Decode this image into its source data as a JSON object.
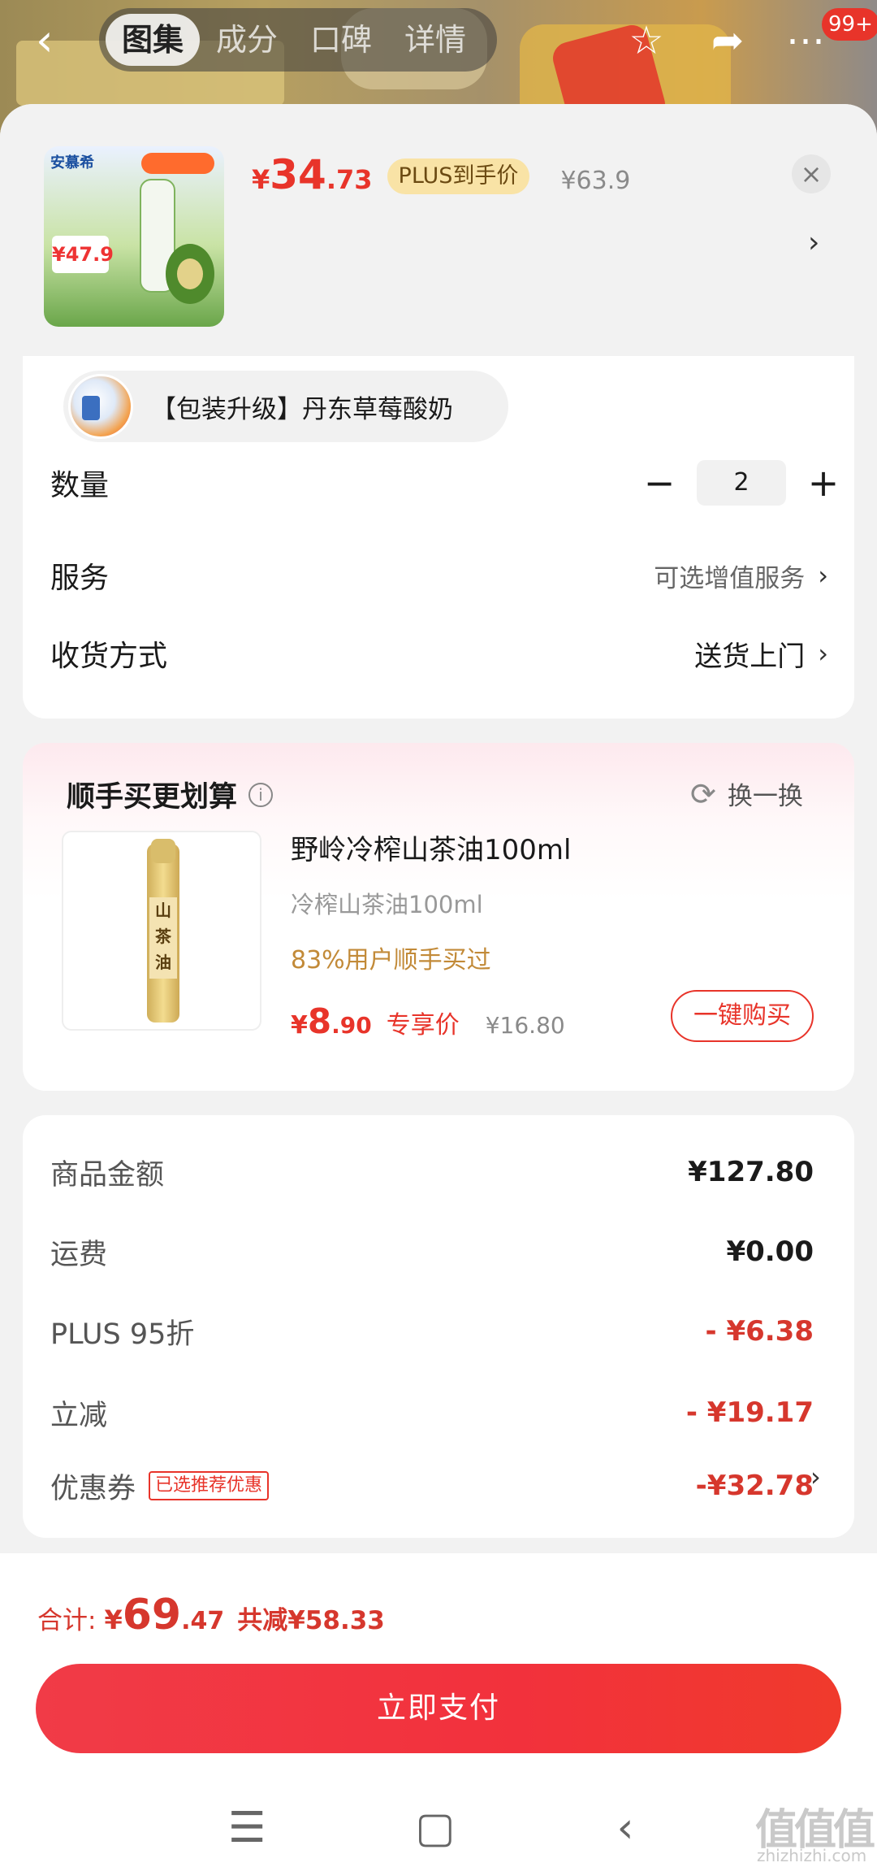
{
  "top_nav": {
    "tabs": [
      "图集",
      "成分",
      "口碑",
      "详情"
    ],
    "active_tab": 0,
    "badge": "99+",
    "icons": [
      "back-icon",
      "star-icon",
      "share-icon",
      "more-icon"
    ]
  },
  "product": {
    "price_symbol": "¥",
    "price_int": "34",
    "price_dec": ".73",
    "plus_tag": "PLUS到手价",
    "original_price": "¥63.9",
    "close_label": "×",
    "thumb_brand": "安慕希",
    "thumb_price": "¥47.9"
  },
  "variant": {
    "label": "【包装升级】丹东草莓酸奶"
  },
  "options": {
    "quantity_label": "数量",
    "quantity_value": "2",
    "minus": "−",
    "plus": "+",
    "service_label": "服务",
    "service_value": "可选增值服务",
    "delivery_label": "收货方式",
    "delivery_value": "送货上门"
  },
  "recommend": {
    "title": "顺手买更划算",
    "swap_label": "换一换",
    "name": "野岭冷榨山茶油100ml",
    "subtitle": "冷榨山茶油100ml",
    "stat": "83%用户顺手买过",
    "price_symbol": "¥",
    "price_int": "8",
    "price_dec": ".90",
    "price_tag": "专享价",
    "original_price": "¥16.80",
    "buy_label": "一键购买",
    "bottle_text": "山茶油"
  },
  "summary": {
    "rows": [
      {
        "label": "商品金额",
        "amount": "¥127.80",
        "red": false
      },
      {
        "label": "运费",
        "amount": "¥0.00",
        "red": false
      },
      {
        "label": "PLUS 95折",
        "amount": "- ¥6.38",
        "red": true
      },
      {
        "label": "立减",
        "amount": "- ¥19.17",
        "red": true
      },
      {
        "label": "优惠券",
        "amount": "-¥32.78",
        "red": true
      }
    ],
    "coupon_tag": "已选推荐优惠"
  },
  "footer": {
    "total_label": "合计:",
    "total_symbol": "¥",
    "total_int": "69",
    "total_dec": ".47",
    "saved": "共减¥58.33",
    "pay_label": "立即支付"
  },
  "watermark": {
    "main": "值值值",
    "sub": "zhizhizhi.com"
  },
  "colors": {
    "accent_red": "#e8342a",
    "pay_button": "#f2313c",
    "plus_tag_bg": "#f9e3a6",
    "stat_gold": "#c28a38"
  }
}
